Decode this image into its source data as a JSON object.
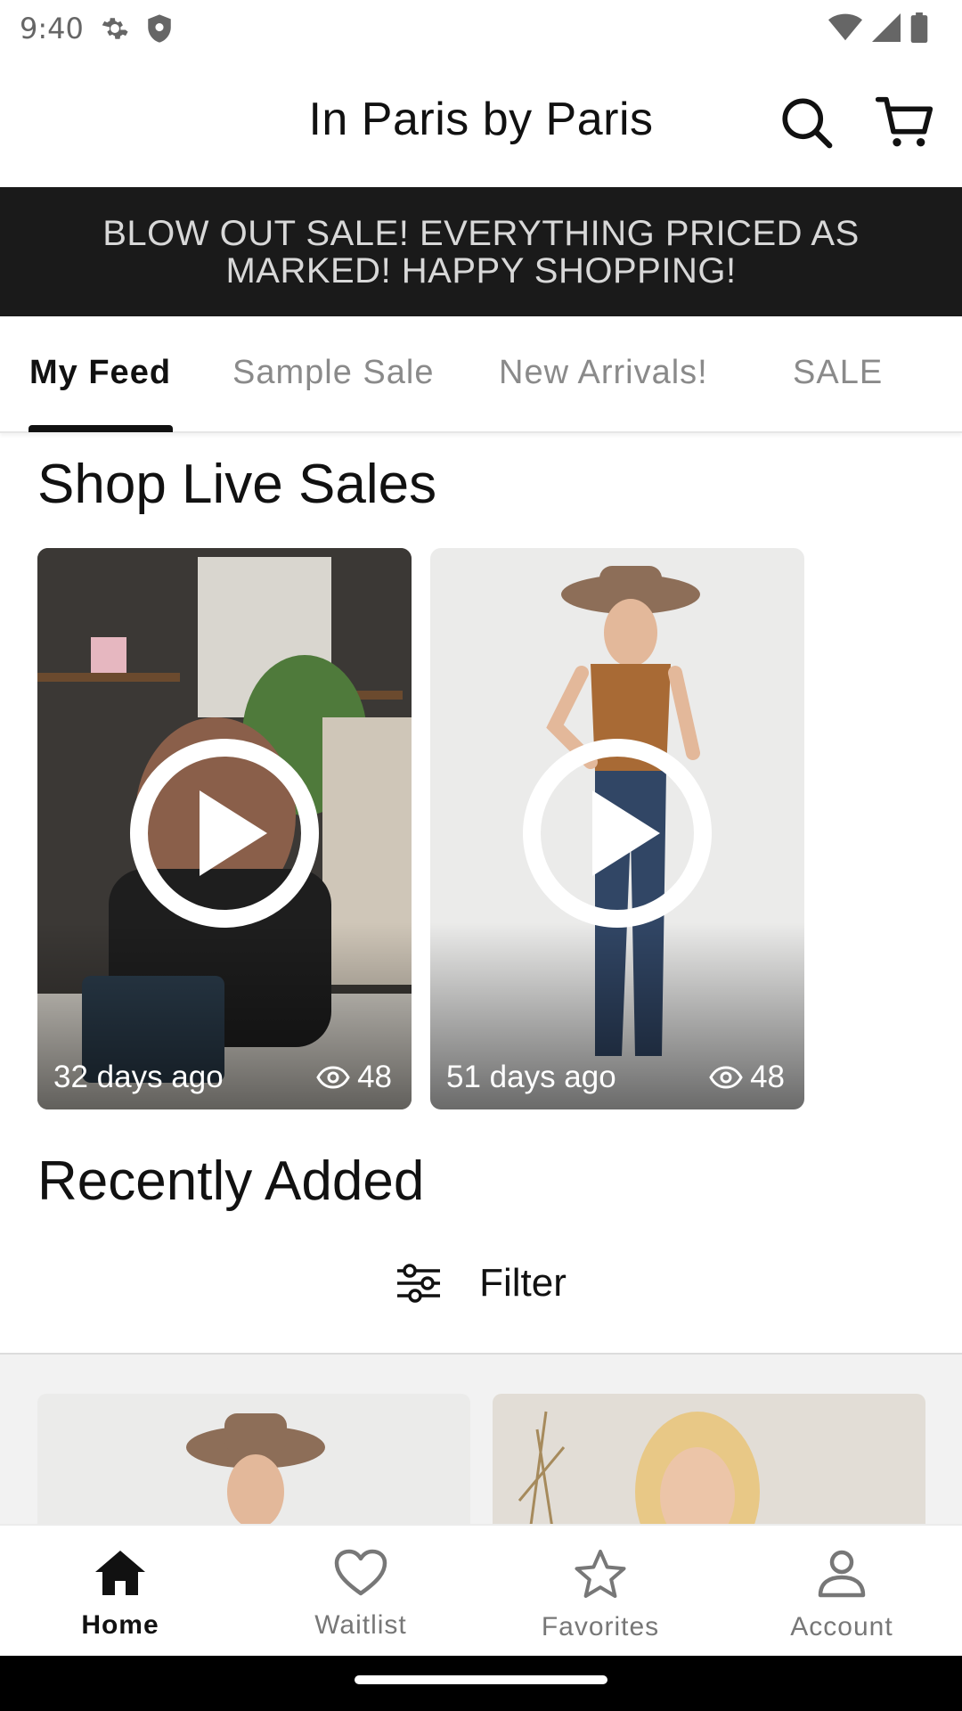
{
  "status_bar": {
    "time": "9:40"
  },
  "header": {
    "title": "In Paris by Paris"
  },
  "banner": {
    "text": "BLOW OUT SALE! EVERYTHING PRICED AS MARKED! HAPPY SHOPPING!"
  },
  "tabs": [
    {
      "label": "My Feed",
      "active": true
    },
    {
      "label": "Sample Sale"
    },
    {
      "label": "New Arrivals!"
    },
    {
      "label": "SALE"
    }
  ],
  "live_section": {
    "title": "Shop Live Sales",
    "videos": [
      {
        "age": "32 days ago",
        "views": "48"
      },
      {
        "age": "51 days ago",
        "views": "48"
      }
    ]
  },
  "recent_section": {
    "title": "Recently Added",
    "filter_label": "Filter"
  },
  "bottom_nav": [
    {
      "label": "Home",
      "icon": "home-icon",
      "active": true
    },
    {
      "label": "Waitlist",
      "icon": "heart-icon"
    },
    {
      "label": "Favorites",
      "icon": "star-icon"
    },
    {
      "label": "Account",
      "icon": "person-icon"
    }
  ],
  "colors": {
    "banner_bg": "#1a1a1a",
    "banner_text": "#d8d8d8",
    "active": "#111111",
    "inactive": "#8a8a8a"
  }
}
